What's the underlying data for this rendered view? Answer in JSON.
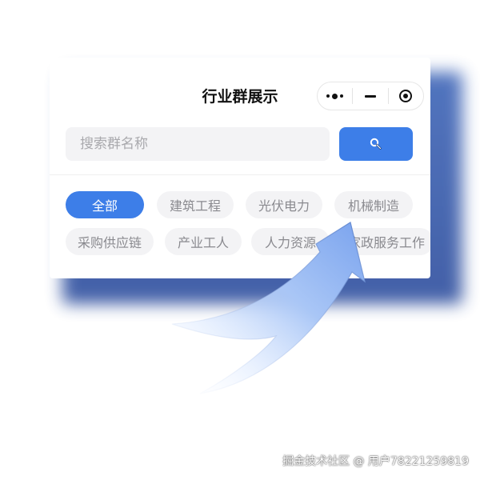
{
  "header": {
    "title": "行业群展示"
  },
  "capsule": {
    "more_icon": "more-dots-icon",
    "minimize_icon": "minimize-icon",
    "close_icon": "target-circle-icon"
  },
  "search": {
    "placeholder": "搜索群名称",
    "value": "",
    "button_icon": "search-icon"
  },
  "tags": [
    {
      "label": "全部",
      "active": true
    },
    {
      "label": "建筑工程",
      "active": false
    },
    {
      "label": "光伏电力",
      "active": false
    },
    {
      "label": "机械制造",
      "active": false
    },
    {
      "label": "采购供应链",
      "active": false
    },
    {
      "label": "产业工人",
      "active": false
    },
    {
      "label": "人力资源",
      "active": false
    },
    {
      "label": "家政服务工作",
      "active": false
    }
  ],
  "colors": {
    "accent": "#3d7ee8",
    "shadow": "#2f4f9e",
    "arrow": "#8fb4f2"
  },
  "watermark": "掘金技术社区 @ 用户78221259819"
}
